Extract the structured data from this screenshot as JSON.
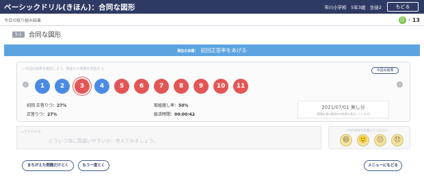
{
  "header": {
    "title": "ベーシックドリル(きほん)：合同な図形",
    "school_info": "市川小学校　5年3組　生徒2",
    "back_label": "もどる"
  },
  "subbar": {
    "breadcrumb": "今日の取り組み結果",
    "times": "×",
    "count": "13"
  },
  "page": {
    "number": "5-1",
    "name": "合同な図形"
  },
  "banner": {
    "label": "現在の目標：",
    "goal": "初回正答率をあげる"
  },
  "results": {
    "hint": "◇今回の結果を確認しよう。間違えた問題を見直そう。",
    "result_button": "今回の結果",
    "questions": [
      {
        "label": "1",
        "status": "correct"
      },
      {
        "label": "2",
        "status": "correct"
      },
      {
        "label": "3",
        "status": "wrong"
      },
      {
        "label": "4",
        "status": "correct"
      },
      {
        "label": "5",
        "status": "wrong"
      },
      {
        "label": "6",
        "status": "wrong"
      },
      {
        "label": "7",
        "status": "wrong"
      },
      {
        "label": "8",
        "status": "wrong"
      },
      {
        "label": "9",
        "status": "wrong"
      },
      {
        "label": "10",
        "status": "wrong"
      },
      {
        "label": "11",
        "status": "wrong"
      }
    ],
    "first_correct_label": "初回 正答りつ：",
    "first_correct_value": "27%",
    "correct_label": "正答りつ：",
    "correct_value": "27%",
    "hint_use_label": "取組度し率：",
    "hint_use_value": "50%",
    "time_label": "総活時間：",
    "time_value": "00:00:42",
    "date": "2021/07/01 実し分",
    "date_note": "(累積計算の範囲内の結果を表示しています)"
  },
  "advice": {
    "caption": "◇アドバイス",
    "text": "どういう時に間違いやすいか、考えてみましょう。"
  },
  "mood": {
    "caption": "◇今の気持ちを選んでください",
    "faces": [
      "😄",
      "🙂",
      "😐",
      "😞"
    ]
  },
  "footer": {
    "retry_wrong": "まちがえた問題だけとく",
    "retry_all": "もう一度とく",
    "menu": "メニューにもどる"
  },
  "colors": {
    "header_bg": "#2e3a63",
    "banner_bg": "#5ca3e0",
    "correct": "#4a8be4",
    "wrong": "#e35656"
  }
}
